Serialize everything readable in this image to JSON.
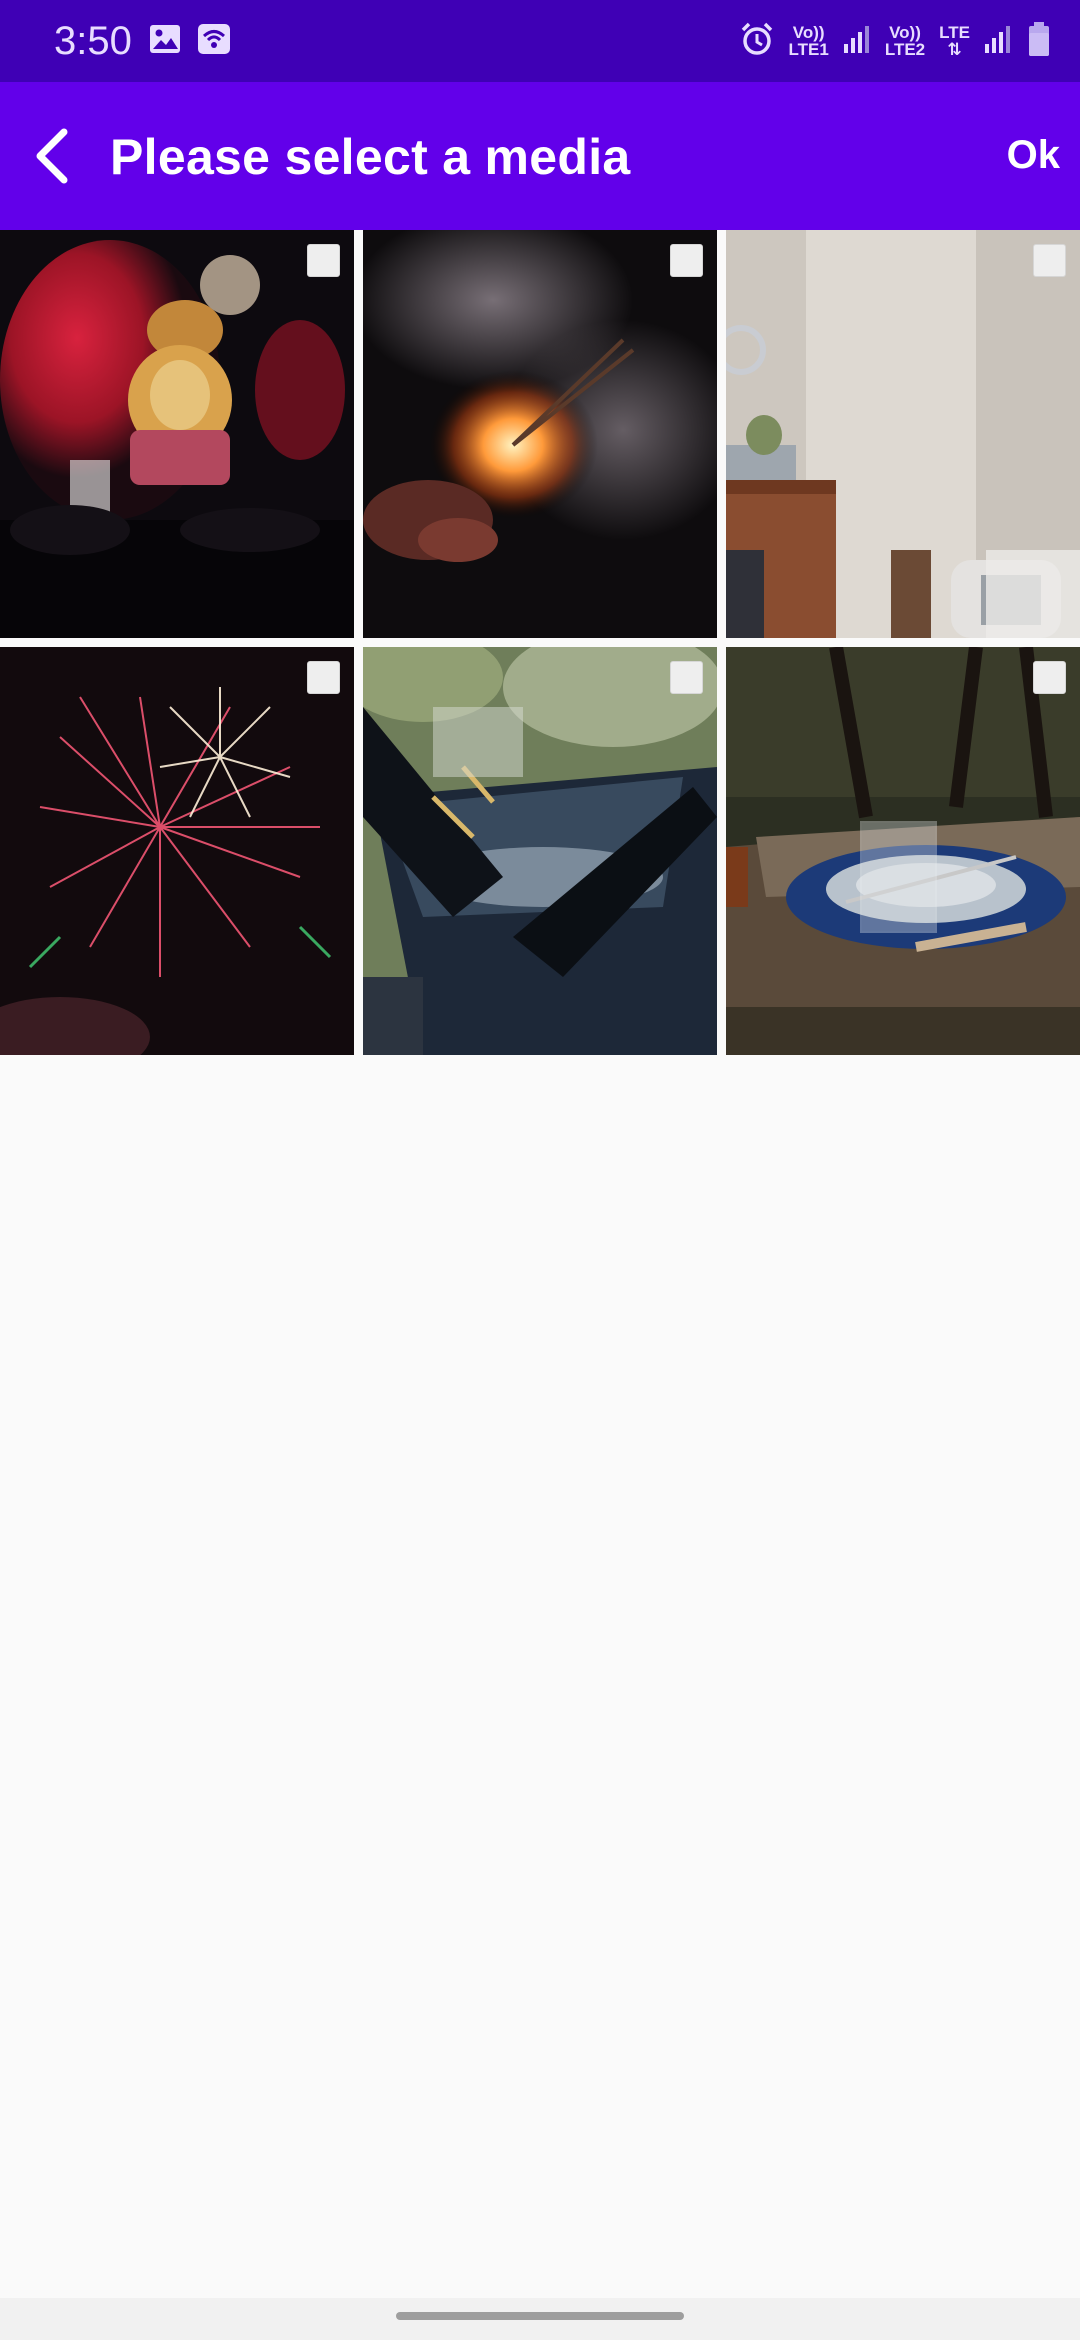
{
  "status_bar": {
    "time": "3:50",
    "sim1_top": "Vo))",
    "sim1_bottom": "LTE1",
    "sim2_top": "Vo))",
    "sim2_bottom": "LTE2",
    "data_type": "LTE",
    "icons": [
      "image-icon",
      "wifi-icon",
      "alarm-icon",
      "signal-icon",
      "signal-icon",
      "signal-icon",
      "battery-icon"
    ]
  },
  "app_bar": {
    "title": "Please select a media",
    "ok_label": "Ok",
    "back_icon": "chevron-left-icon"
  },
  "media_grid": {
    "items": [
      {
        "subject": "ganesha-idol",
        "selected": false
      },
      {
        "subject": "sparkler",
        "selected": false
      },
      {
        "subject": "living-room-fireplace",
        "selected": false
      },
      {
        "subject": "fireworks",
        "selected": false
      },
      {
        "subject": "champagne-ice-bucket",
        "selected": false
      },
      {
        "subject": "table-setting",
        "selected": false
      }
    ]
  },
  "colors": {
    "status_bar": "#3f00b5",
    "app_bar": "#6200ea",
    "background": "#fafafa"
  }
}
